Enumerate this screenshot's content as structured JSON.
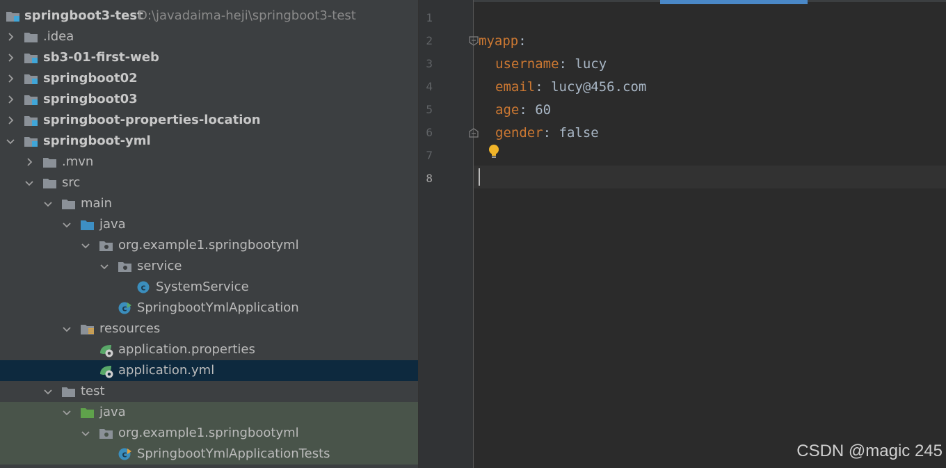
{
  "project_tree": {
    "root": {
      "name": "springboot3-test",
      "path": "D:\\javadaima-heji\\springboot3-test"
    },
    "items": [
      {
        "label": ".idea",
        "bold": false
      },
      {
        "label": "sb3-01-first-web",
        "bold": true
      },
      {
        "label": "springboot02",
        "bold": true
      },
      {
        "label": "springboot03",
        "bold": true
      },
      {
        "label": "springboot-properties-location",
        "bold": true
      },
      {
        "label": "springboot-yml",
        "bold": true
      },
      {
        "label": ".mvn"
      },
      {
        "label": "src"
      },
      {
        "label": "main"
      },
      {
        "label": "java"
      },
      {
        "label": "org.example1.springbootyml"
      },
      {
        "label": "service"
      },
      {
        "label": "SystemService"
      },
      {
        "label": "SpringbootYmlApplication"
      },
      {
        "label": "resources"
      },
      {
        "label": "application.properties"
      },
      {
        "label": "application.yml",
        "selected": true
      },
      {
        "label": "test"
      },
      {
        "label": "java"
      },
      {
        "label": "org.example1.springbootyml"
      },
      {
        "label": "SpringbootYmlApplicationTests"
      }
    ]
  },
  "editor": {
    "line_numbers": [
      "1",
      "2",
      "3",
      "4",
      "5",
      "6",
      "7",
      "8"
    ],
    "current_line": "8",
    "lines": [
      {
        "key": "",
        "sep": "",
        "value": ""
      },
      {
        "key": "myapp",
        "sep": ":",
        "value": ""
      },
      {
        "key": "username",
        "sep": ": ",
        "value": "lucy"
      },
      {
        "key": "email",
        "sep": ": ",
        "value": "lucy@456.com"
      },
      {
        "key": "age",
        "sep": ": ",
        "value": "60"
      },
      {
        "key": "gender",
        "sep": ": ",
        "value": "false"
      },
      {
        "key": "",
        "sep": "",
        "value": ""
      },
      {
        "key": "",
        "sep": "",
        "value": ""
      }
    ]
  },
  "watermark": "CSDN @magic 245",
  "icons": {
    "expand": "chevron-right-icon",
    "collapse": "chevron-down-icon",
    "folder": "folder-icon",
    "module": "module-folder-icon",
    "package": "package-icon",
    "class": "class-icon",
    "spring_boot_app": "spring-boot-app-icon",
    "spring_config": "spring-config-icon",
    "intention": "lightbulb-icon"
  },
  "colors": {
    "selection": "#0d293e",
    "test_bg": "#49544a",
    "yaml_key": "#cc7832",
    "text": "#a9b7c6",
    "tab_accent": "#4a88c7"
  }
}
